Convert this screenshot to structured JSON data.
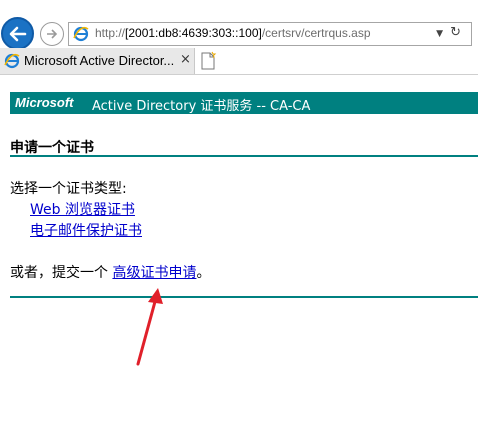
{
  "browser": {
    "address": {
      "url_prefix": "http://",
      "url_host": "[2001:db8:4639:303::100]",
      "url_path": "/certsrv/certrqus.asp"
    },
    "tab": {
      "title": "Microsoft Active Director...",
      "close": "×"
    },
    "icons": {
      "back": "back-arrow-icon",
      "forward": "forward-arrow-icon",
      "ie": "ie-logo-icon",
      "refresh": "refresh-icon",
      "new_tab": "new-tab-icon"
    }
  },
  "page": {
    "banner": {
      "brand": "Microsoft",
      "title": "Active Directory 证书服务  --  CA-CA"
    },
    "heading": "申请一个证书",
    "intro": "选择一个证书类型:",
    "cert_types": [
      "Web 浏览器证书",
      "电子邮件保护证书"
    ],
    "alt_prefix": "或者，提交一个",
    "alt_link": "高级证书申请",
    "alt_suffix": "。",
    "annotation": "red-arrow-pointing-to-advanced-request"
  },
  "colors": {
    "banner": "#008080",
    "link": "#0000cc",
    "annotation": "#e0202a"
  }
}
